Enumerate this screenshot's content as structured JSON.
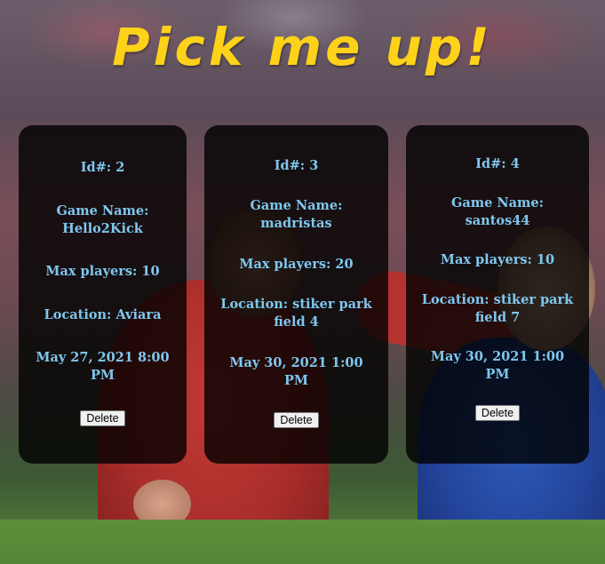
{
  "page": {
    "title": "Pick me up!",
    "title_color": "#ffd21a",
    "field_color": "#7fc7ee"
  },
  "games": [
    {
      "id": "Id#: 2",
      "name": "Game Name: Hello2Kick",
      "max_players": "Max players: 10",
      "location": "Location: Aviara",
      "datetime": "May 27, 2021 8:00 PM",
      "delete_label": "Delete"
    },
    {
      "id": "Id#: 3",
      "name": "Game Name: madristas",
      "max_players": "Max players: 20",
      "location": "Location: stiker park field 4",
      "datetime": "May 30, 2021 1:00 PM",
      "delete_label": "Delete"
    },
    {
      "id": "Id#: 4",
      "name": "Game Name: santos44",
      "max_players": "Max players: 10",
      "location": "Location: stiker park field 7",
      "datetime": "May 30, 2021 1:00 PM",
      "delete_label": "Delete"
    }
  ]
}
